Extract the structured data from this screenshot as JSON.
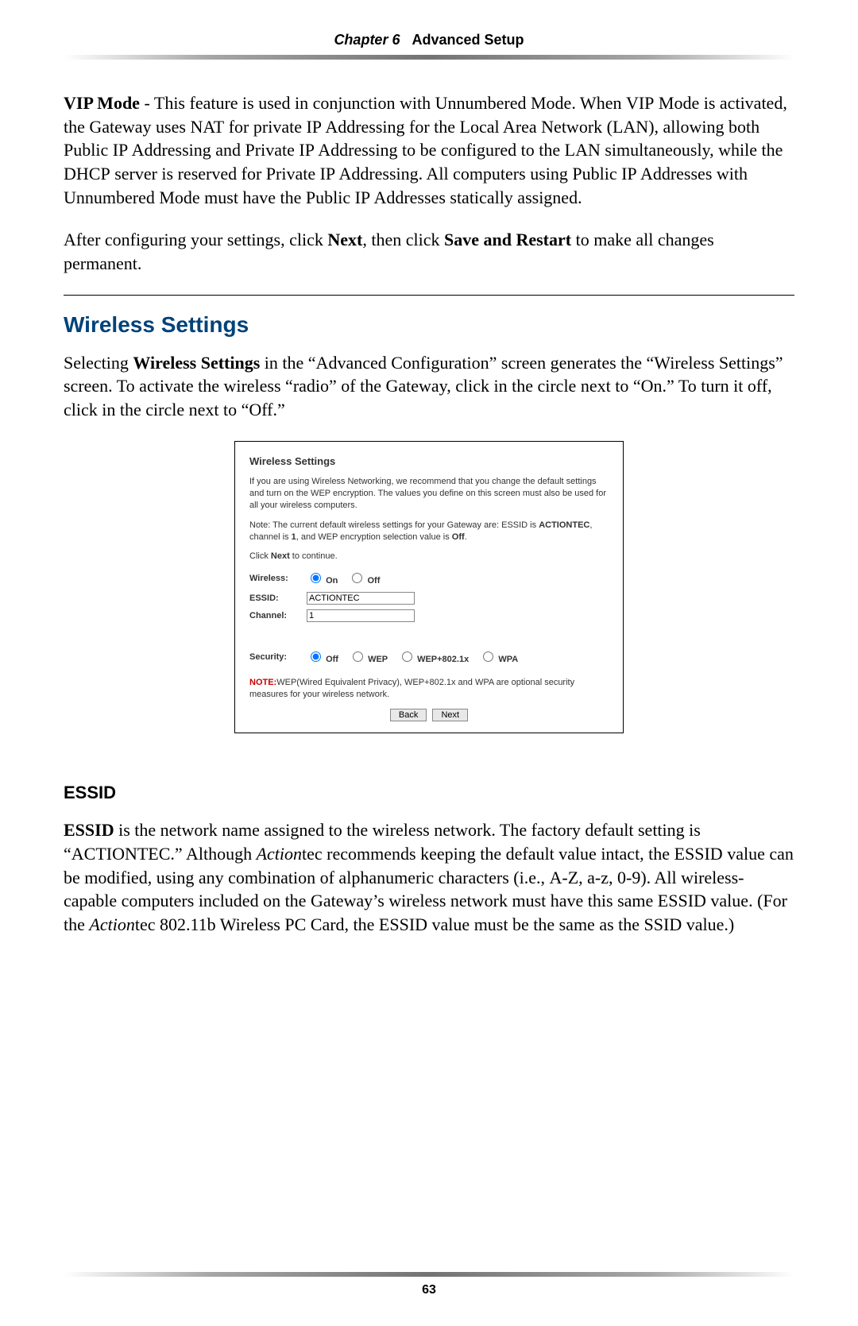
{
  "header": {
    "chapter": "Chapter 6",
    "title": "Advanced Setup"
  },
  "vip_para_html": "<span class='bold'>VIP Mode</span> - This feature is used in conjunction with Unnumbered Mode. When <span class='smallcaps'>VIP</span> Mode is activated, the Gateway uses <span class='smallcaps'>NAT</span> for private <span class='smallcaps'>IP</span> Addressing for the Local Area Network (<span class='smallcaps'>LAN</span>), allowing both Public <span class='smallcaps'>IP</span> Addressing and Private <span class='smallcaps'>IP</span> Addressing to be configured to the <span class='smallcaps'>LAN</span> simultaneously, while the <span class='smallcaps'>DHCP</span> server is reserved for Private <span class='smallcaps'>IP</span> Addressing. All computers using Public <span class='smallcaps'>IP</span> Addresses with Unnumbered Mode must have the Public <span class='smallcaps'>IP</span> Addresses statically assigned.",
  "after_config_html": "After configuring your settings, click <span class='bold'>Next</span>, then click <span class='bold'>Save and Restart</span> to make all changes permanent.",
  "wireless_section": {
    "title": "Wireless Settings",
    "intro_html": "Selecting <span class='bold'>Wireless Settings</span> in the &ldquo;Advanced Configuration&rdquo; screen generates the &ldquo;Wireless Settings&rdquo; screen. To activate the wireless &ldquo;radio&rdquo; of the Gateway, click in the circle next to &ldquo;On.&rdquo; To turn it off, click in the circle next to &ldquo;Off.&rdquo;"
  },
  "panel": {
    "title": "Wireless Settings",
    "p1": "If you are using Wireless Networking, we recommend that you change the default settings and turn on the WEP encryption. The values you define on this screen must also be used for all your wireless computers.",
    "p2_html": "Note: The current default wireless settings for your Gateway are: ESSID is <b>ACTIONTEC</b>, channel is <b>1</b>, and WEP encryption selection value is <b>Off</b>.",
    "p3_html": "Click <b>Next</b> to continue.",
    "labels": {
      "wireless": "Wireless:",
      "essid": "ESSID:",
      "channel": "Channel:",
      "security": "Security:"
    },
    "wireless_options": {
      "on": "On",
      "off": "Off",
      "selected": "on"
    },
    "essid_value": "ACTIONTEC",
    "channel_value": "1",
    "security_options": {
      "off": "Off",
      "wep": "WEP",
      "wep8021x": "WEP+802.1x",
      "wpa": "WPA",
      "selected": "off"
    },
    "note_html": "<span class='note-red'>NOTE:</span>WEP(Wired Equivalent Privacy), WEP+802.1x and WPA are optional security measures for your wireless network.",
    "buttons": {
      "back": "Back",
      "next": "Next"
    }
  },
  "essid_section": {
    "title": "ESSID",
    "para_html": "<span class='bold'>ESSID</span> is the network name assigned to the wireless network. The factory default setting is &ldquo;<span style='font-variant:small-caps'>ACTIONTEC</span>.&rdquo; Although <span class='italic'>Action</span>tec recommends keeping the default value intact, the <span class='smallcaps'>ESSID</span> value can be modified, using any combination of alphanumeric characters (i.e., <span class='smallcaps'>A-Z</span>, a-z, 0-9). All wireless-capable computers included on the Gateway&rsquo;s wireless network must have this same <span class='smallcaps'>ESSID</span> value. (For the <span class='italic'>Action</span>tec 802.11b Wireless <span class='smallcaps'>PC</span> Card, the <span class='smallcaps'>ESSID</span> value must be the same as the <span class='smallcaps'>SSID</span> value.)"
  },
  "page_number": "63"
}
